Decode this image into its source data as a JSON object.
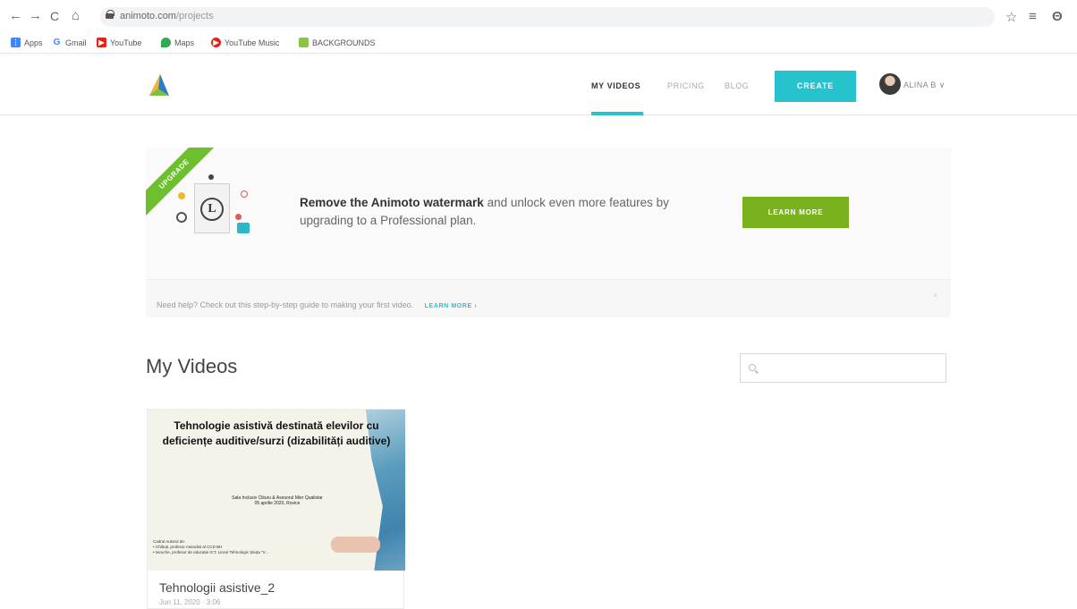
{
  "browser": {
    "back": "←",
    "forward": "→",
    "reload": "C",
    "home": "⌂",
    "url_host": "animoto.com",
    "url_path": "/projects",
    "star": "☆",
    "menu": "≡",
    "profile": "Θ"
  },
  "bookmarks": [
    {
      "label": "Apps",
      "icon": "apps-grid-icon",
      "color": "#4285f4"
    },
    {
      "label": "Gmail",
      "icon": "google-g-icon",
      "color": "#4285f4"
    },
    {
      "label": "YouTube",
      "icon": "youtube-icon",
      "color": "#e62117"
    },
    {
      "label": "Maps",
      "icon": "maps-pin-icon",
      "color": "#34a853"
    },
    {
      "label": "YouTube Music",
      "icon": "youtube-music-icon",
      "color": "#e62117"
    },
    {
      "label": "BACKGROUNDS",
      "icon": "folder-icon",
      "color": "#8bc34a"
    }
  ],
  "nav": {
    "my_videos": "MY VIDEOS",
    "pricing": "PRICING",
    "blog": "BLOG",
    "create": "CREATE",
    "user": "ALINA B",
    "user_chevron": "∨"
  },
  "banner": {
    "ribbon": "UPGRADE",
    "bold": "Remove the Animoto watermark",
    "rest": " and unlock even more features by upgrading to a Professional plan.",
    "learn_more": "LEARN MORE",
    "icon_letter": "L",
    "help_text": "Need help? Check out this step-by-step guide to making your first video.",
    "help_link": "LEARN MORE ›",
    "close": "×"
  },
  "videos": {
    "title": "My Videos",
    "search_placeholder": "",
    "items": [
      {
        "thumb_title": "Tehnologie asistivă destinată elevilor cu deficiențe auditive/surzi (dizabilități auditive)",
        "thumb_subtitle": "Sala Inclusiv Clituru & Asesorul Mier Qualistar\n05 aprilie 2020, Rovice",
        "thumb_authors": "Cadrul Autorul de:\n • Chibuți, profesor metodist al CCD BH\n • Iacuche, profesor de educație ICT, Liceul Tehnologic Știuța \"V...",
        "title": "Tehnologii asistive_2",
        "date": "Jun 11, 2020 · 3:06"
      }
    ]
  },
  "colors": {
    "accent": "#27c3cc",
    "upgrade_green": "#7ab21f",
    "ribbon_green": "#6cbf2e"
  }
}
